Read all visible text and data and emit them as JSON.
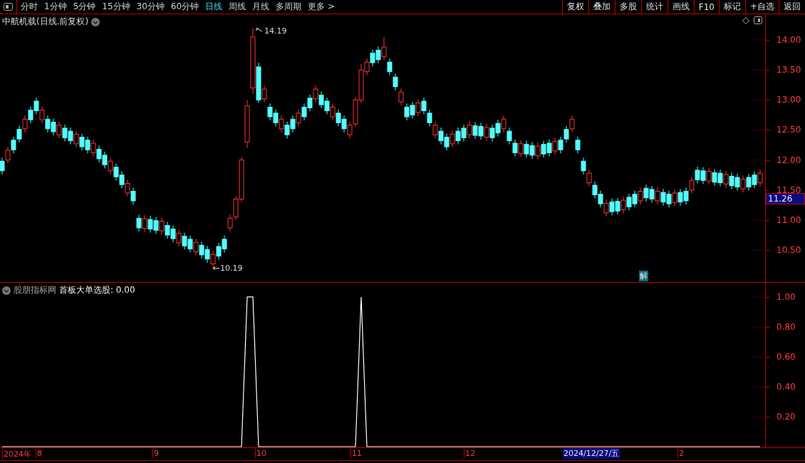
{
  "toolbar": {
    "periods": [
      {
        "label": "分时",
        "selected": false
      },
      {
        "label": "1分钟",
        "selected": false
      },
      {
        "label": "5分钟",
        "selected": false
      },
      {
        "label": "15分钟",
        "selected": false
      },
      {
        "label": "30分钟",
        "selected": false
      },
      {
        "label": "60分钟",
        "selected": false
      },
      {
        "label": "日线",
        "selected": true
      },
      {
        "label": "周线",
        "selected": false
      },
      {
        "label": "月线",
        "selected": false
      },
      {
        "label": "多周期",
        "selected": false
      },
      {
        "label": "更多 >",
        "selected": false
      }
    ],
    "buttons": [
      "复权",
      "叠加",
      "多股",
      "统计",
      "画线",
      "F10",
      "标记",
      "+自选",
      "返回"
    ]
  },
  "price_panel": {
    "title": "中航机载(日线.前复权)",
    "high_label": "14.19",
    "low_label": "10.19",
    "marker": "解",
    "last_price": "11.26",
    "chart_data": {
      "type": "candlestick",
      "ylim": [
        9.967,
        14.427
      ],
      "yticks": [
        {
          "value": 14,
          "label": "14.00"
        },
        {
          "value": 13.5,
          "label": "13.50"
        },
        {
          "value": 13,
          "label": "13.00"
        },
        {
          "value": 12.5,
          "label": "12.50"
        },
        {
          "value": 12,
          "label": "12.00"
        },
        {
          "value": 11.5,
          "label": "11.50"
        },
        {
          "value": 11,
          "label": "11.00"
        },
        {
          "value": 10.5,
          "label": "10.50"
        }
      ],
      "ohlc": [
        [
          11.98,
          12.04,
          11.76,
          11.82
        ],
        [
          12.0,
          12.22,
          11.94,
          12.16
        ],
        [
          12.33,
          12.39,
          12.11,
          12.17
        ],
        [
          12.51,
          12.57,
          12.29,
          12.35
        ],
        [
          12.52,
          12.74,
          12.46,
          12.68
        ],
        [
          12.83,
          12.89,
          12.61,
          12.67
        ],
        [
          12.98,
          13.04,
          12.76,
          12.82
        ],
        [
          12.67,
          12.89,
          12.61,
          12.83
        ],
        [
          12.68,
          12.74,
          12.46,
          12.52
        ],
        [
          12.63,
          12.69,
          12.41,
          12.47
        ],
        [
          12.42,
          12.64,
          12.36,
          12.58
        ],
        [
          12.53,
          12.59,
          12.31,
          12.37
        ],
        [
          12.48,
          12.54,
          12.26,
          12.32
        ],
        [
          12.27,
          12.49,
          12.21,
          12.43
        ],
        [
          12.38,
          12.44,
          12.16,
          12.22
        ],
        [
          12.33,
          12.39,
          12.11,
          12.17
        ],
        [
          12.12,
          12.34,
          12.06,
          12.28
        ],
        [
          12.18,
          12.24,
          11.96,
          12.02
        ],
        [
          12.08,
          12.14,
          11.86,
          11.92
        ],
        [
          11.82,
          12.04,
          11.76,
          11.98
        ],
        [
          11.88,
          11.94,
          11.66,
          11.72
        ],
        [
          11.75,
          11.81,
          11.53,
          11.59
        ],
        [
          11.45,
          11.67,
          11.39,
          11.61
        ],
        [
          11.48,
          11.54,
          11.26,
          11.32
        ],
        [
          11.03,
          11.09,
          10.81,
          10.87
        ],
        [
          10.86,
          11.08,
          10.8,
          11.02
        ],
        [
          11.01,
          11.07,
          10.79,
          10.85
        ],
        [
          10.99,
          11.05,
          10.77,
          10.83
        ],
        [
          10.82,
          11.04,
          10.76,
          10.98
        ],
        [
          10.91,
          10.97,
          10.69,
          10.75
        ],
        [
          10.85,
          10.91,
          10.63,
          10.69
        ],
        [
          10.62,
          10.84,
          10.56,
          10.78
        ],
        [
          10.73,
          10.79,
          10.51,
          10.57
        ],
        [
          10.68,
          10.74,
          10.46,
          10.52
        ],
        [
          10.47,
          10.69,
          10.41,
          10.63
        ],
        [
          10.58,
          10.64,
          10.36,
          10.42
        ],
        [
          10.51,
          10.57,
          10.29,
          10.35
        ],
        [
          10.27,
          10.49,
          10.19,
          10.43
        ],
        [
          10.56,
          10.62,
          10.34,
          10.4
        ],
        [
          10.68,
          10.74,
          10.46,
          10.52
        ],
        [
          10.87,
          11.09,
          10.81,
          11.03
        ],
        [
          11.05,
          11.4,
          11.0,
          11.35
        ],
        [
          11.35,
          12.05,
          11.3,
          12.0
        ],
        [
          12.3,
          13.0,
          12.2,
          12.9
        ],
        [
          13.2,
          14.19,
          13.1,
          14.05
        ],
        [
          13.55,
          13.62,
          12.95,
          13.0
        ],
        [
          13.02,
          13.24,
          12.96,
          13.18
        ],
        [
          12.88,
          12.94,
          12.66,
          12.72
        ],
        [
          12.78,
          12.84,
          12.56,
          12.62
        ],
        [
          12.52,
          12.74,
          12.46,
          12.68
        ],
        [
          12.58,
          12.64,
          12.36,
          12.42
        ],
        [
          12.68,
          12.74,
          12.46,
          12.52
        ],
        [
          12.62,
          12.84,
          12.56,
          12.78
        ],
        [
          12.88,
          12.94,
          12.66,
          12.72
        ],
        [
          13.03,
          13.09,
          12.81,
          12.87
        ],
        [
          13.02,
          13.24,
          12.96,
          13.18
        ],
        [
          13.08,
          13.14,
          12.86,
          12.92
        ],
        [
          12.98,
          13.04,
          12.76,
          12.82
        ],
        [
          12.72,
          12.94,
          12.66,
          12.88
        ],
        [
          12.78,
          12.84,
          12.56,
          12.62
        ],
        [
          12.68,
          12.74,
          12.46,
          12.52
        ],
        [
          12.42,
          12.64,
          12.36,
          12.58
        ],
        [
          12.6,
          13.05,
          12.55,
          13.0
        ],
        [
          13.0,
          13.6,
          12.95,
          13.5
        ],
        [
          13.47,
          13.69,
          13.41,
          13.63
        ],
        [
          13.78,
          13.84,
          13.56,
          13.62
        ],
        [
          13.83,
          13.89,
          13.61,
          13.67
        ],
        [
          13.72,
          14.05,
          13.66,
          13.88
        ],
        [
          13.63,
          13.69,
          13.41,
          13.47
        ],
        [
          13.38,
          13.44,
          13.16,
          13.22
        ],
        [
          12.97,
          13.19,
          12.91,
          13.13
        ],
        [
          12.88,
          12.94,
          12.66,
          12.72
        ],
        [
          12.91,
          12.97,
          12.69,
          12.75
        ],
        [
          12.79,
          13.01,
          12.73,
          12.95
        ],
        [
          12.98,
          13.04,
          12.76,
          12.82
        ],
        [
          12.78,
          12.84,
          12.56,
          12.62
        ],
        [
          12.42,
          12.64,
          12.36,
          12.58
        ],
        [
          12.48,
          12.54,
          12.26,
          12.32
        ],
        [
          12.38,
          12.44,
          12.16,
          12.22
        ],
        [
          12.27,
          12.49,
          12.21,
          12.43
        ],
        [
          12.48,
          12.54,
          12.26,
          12.32
        ],
        [
          12.53,
          12.59,
          12.31,
          12.37
        ],
        [
          12.42,
          12.64,
          12.36,
          12.58
        ],
        [
          12.57,
          12.63,
          12.35,
          12.41
        ],
        [
          12.56,
          12.62,
          12.34,
          12.4
        ],
        [
          12.38,
          12.6,
          12.32,
          12.54
        ],
        [
          12.53,
          12.59,
          12.31,
          12.37
        ],
        [
          12.61,
          12.67,
          12.39,
          12.45
        ],
        [
          12.52,
          12.74,
          12.46,
          12.68
        ],
        [
          12.48,
          12.54,
          12.26,
          12.32
        ],
        [
          12.28,
          12.34,
          12.06,
          12.12
        ],
        [
          12.11,
          12.33,
          12.05,
          12.27
        ],
        [
          12.26,
          12.32,
          12.04,
          12.1
        ],
        [
          12.24,
          12.3,
          12.02,
          12.08
        ],
        [
          12.07,
          12.29,
          12.01,
          12.23
        ],
        [
          12.26,
          12.32,
          12.04,
          12.1
        ],
        [
          12.28,
          12.34,
          12.06,
          12.12
        ],
        [
          12.15,
          12.37,
          12.09,
          12.31
        ],
        [
          12.33,
          12.39,
          12.11,
          12.17
        ],
        [
          12.51,
          12.57,
          12.29,
          12.35
        ],
        [
          12.52,
          12.74,
          12.46,
          12.68
        ],
        [
          12.33,
          12.39,
          12.11,
          12.17
        ],
        [
          11.98,
          12.04,
          11.76,
          11.82
        ],
        [
          11.62,
          11.84,
          11.56,
          11.78
        ],
        [
          11.58,
          11.64,
          11.36,
          11.42
        ],
        [
          11.43,
          11.49,
          11.21,
          11.27
        ],
        [
          11.12,
          11.34,
          11.06,
          11.28
        ],
        [
          11.3,
          11.36,
          11.08,
          11.14
        ],
        [
          11.31,
          11.37,
          11.09,
          11.15
        ],
        [
          11.17,
          11.39,
          11.11,
          11.33
        ],
        [
          11.38,
          11.44,
          11.16,
          11.22
        ],
        [
          11.43,
          11.49,
          11.21,
          11.27
        ],
        [
          11.32,
          11.54,
          11.26,
          11.48
        ],
        [
          11.53,
          11.59,
          11.31,
          11.37
        ],
        [
          11.51,
          11.57,
          11.29,
          11.35
        ],
        [
          11.32,
          11.54,
          11.26,
          11.48
        ],
        [
          11.46,
          11.52,
          11.24,
          11.3
        ],
        [
          11.43,
          11.49,
          11.21,
          11.27
        ],
        [
          11.29,
          11.51,
          11.23,
          11.45
        ],
        [
          11.46,
          11.52,
          11.24,
          11.3
        ],
        [
          11.48,
          11.54,
          11.26,
          11.32
        ],
        [
          11.5,
          11.72,
          11.44,
          11.66
        ],
        [
          11.83,
          11.89,
          11.61,
          11.67
        ],
        [
          11.82,
          11.88,
          11.6,
          11.66
        ],
        [
          11.65,
          11.87,
          11.59,
          11.81
        ],
        [
          11.79,
          11.85,
          11.57,
          11.63
        ],
        [
          11.78,
          11.84,
          11.56,
          11.62
        ],
        [
          11.6,
          11.82,
          11.54,
          11.76
        ],
        [
          11.73,
          11.79,
          11.51,
          11.57
        ],
        [
          11.71,
          11.77,
          11.49,
          11.55
        ],
        [
          11.52,
          11.74,
          11.46,
          11.68
        ],
        [
          11.71,
          11.77,
          11.49,
          11.55
        ],
        [
          11.75,
          11.81,
          11.53,
          11.59
        ],
        [
          11.62,
          11.84,
          11.56,
          11.78
        ]
      ]
    }
  },
  "indicator_panel": {
    "source": "股朋指标网",
    "name": "首板大单选股: 0.00",
    "chart_data": {
      "type": "line",
      "ylim": [
        0,
        1.095
      ],
      "yticks": [
        {
          "value": 1,
          "label": "1.00"
        },
        {
          "value": 0.8,
          "label": "0.80"
        },
        {
          "value": 0.6,
          "label": "0.60"
        },
        {
          "value": 0.4,
          "label": "0.40"
        },
        {
          "value": 0.2,
          "label": "0.20"
        }
      ],
      "series": [
        {
          "color": "#ffffff",
          "values": [
            0,
            0,
            0,
            0,
            0,
            0,
            0,
            0,
            0,
            0,
            0,
            0,
            0,
            0,
            0,
            0,
            0,
            0,
            0,
            0,
            0,
            0,
            0,
            0,
            0,
            0,
            0,
            0,
            0,
            0,
            0,
            0,
            0,
            0,
            0,
            0,
            0,
            0,
            0,
            0,
            0,
            0,
            0,
            1,
            1,
            0,
            0,
            0,
            0,
            0,
            0,
            0,
            0,
            0,
            0,
            0,
            0,
            0,
            0,
            0,
            0,
            0,
            0,
            1,
            0,
            0,
            0,
            0,
            0,
            0,
            0,
            0,
            0,
            0,
            0,
            0,
            0,
            0,
            0,
            0,
            0,
            0,
            0,
            0,
            0,
            0,
            0,
            0,
            0,
            0,
            0,
            0,
            0,
            0,
            0,
            0,
            0,
            0,
            0,
            0,
            0,
            0,
            0,
            0,
            0,
            0,
            0,
            0,
            0,
            0,
            0,
            0,
            0,
            0,
            0,
            0,
            0,
            0,
            0,
            0,
            0,
            0,
            0,
            0,
            0,
            0,
            0,
            0,
            0,
            0,
            0,
            0,
            0,
            0
          ]
        }
      ]
    }
  },
  "date_axis": {
    "labels": [
      "2024年",
      "8",
      "9",
      "10",
      "11",
      "12",
      "2"
    ],
    "cursor_date": "2024/12/27/五"
  }
}
